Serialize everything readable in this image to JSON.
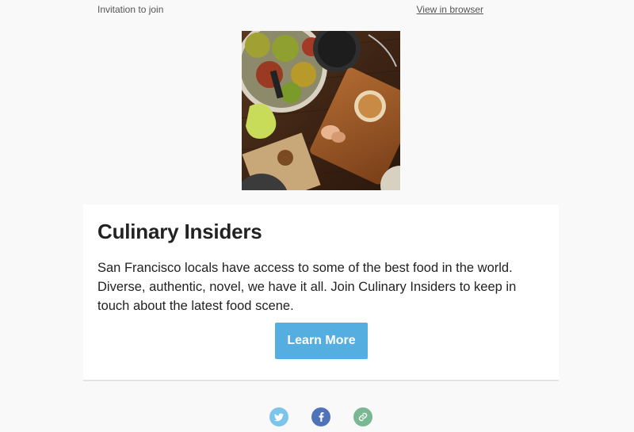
{
  "header": {
    "invitation_text": "Invitation to join",
    "view_in_browser": "View in browser"
  },
  "hero": {
    "image_icon": "food-photo"
  },
  "card": {
    "title": "Culinary Insiders",
    "body": "San Francisco locals have access to some of the best food in the world. Diverse, authentic, novel, we have it all. Join Culinary Insiders to keep in touch about the latest food scene.",
    "cta_label": "Learn More"
  },
  "social": [
    {
      "icon": "twitter-icon",
      "color": "#7dc4ea"
    },
    {
      "icon": "facebook-icon",
      "color": "#4f73b8"
    },
    {
      "icon": "link-icon",
      "color": "#7ab894"
    }
  ],
  "colors": {
    "page_bg": "#f9f9f9",
    "card_bg": "#ffffff",
    "cta_bg": "#55aee0"
  }
}
